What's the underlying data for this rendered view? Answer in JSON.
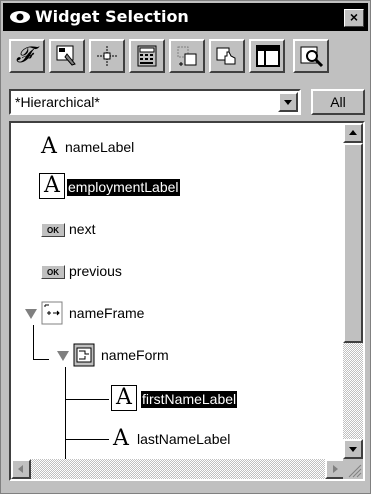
{
  "window": {
    "title": "Widget Selection",
    "close_label": "×"
  },
  "toolbar": {
    "buttons": [
      {
        "name": "script-f-icon",
        "glyph": "𝓕"
      },
      {
        "name": "edit-widget-icon"
      },
      {
        "name": "crosshair-icon"
      },
      {
        "name": "calculator-icon"
      },
      {
        "name": "move-icon"
      },
      {
        "name": "pointer-hand-icon"
      },
      {
        "name": "layout-icon"
      },
      {
        "name": "inspect-icon"
      }
    ]
  },
  "filter": {
    "selected": "*Hierarchical*",
    "all_label": "All"
  },
  "tree": {
    "items": [
      {
        "label": "nameLabel",
        "type": "label",
        "selected": false
      },
      {
        "label": "employmentLabel",
        "type": "label",
        "selected": true
      },
      {
        "label": "next",
        "type": "button",
        "icon_text": "OK",
        "selected": false
      },
      {
        "label": "previous",
        "type": "button",
        "icon_text": "OK",
        "selected": false
      },
      {
        "label": "nameFrame",
        "type": "frame",
        "expanded": true,
        "selected": false
      },
      {
        "label": "nameForm",
        "type": "form",
        "expanded": true,
        "selected": false
      },
      {
        "label": "firstNameLabel",
        "type": "label",
        "selected": true
      },
      {
        "label": "lastNameLabel",
        "type": "label",
        "selected": false
      }
    ]
  },
  "colors": {
    "face": "#c0c0c0",
    "title_bar": "#000000",
    "selection": "#000000"
  }
}
